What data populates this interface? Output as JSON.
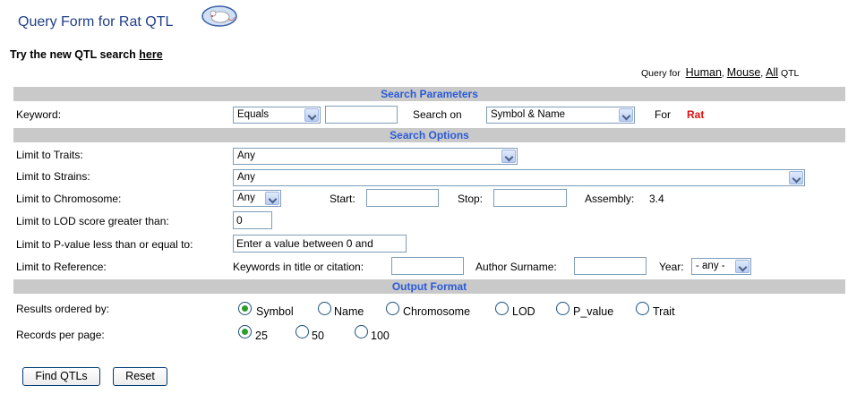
{
  "header": {
    "title": "Query Form for Rat QTL",
    "try_prefix": "Try the new QTL search",
    "try_link": "here"
  },
  "query_for": {
    "prefix": "Query for",
    "links": [
      "Human",
      "Mouse",
      "All"
    ],
    "suffix": "QTL"
  },
  "sections": {
    "search_parameters": "Search Parameters",
    "search_options": "Search Options",
    "output_format": "Output Format"
  },
  "keyword": {
    "label": "Keyword:",
    "match_select": "Equals",
    "value": "",
    "search_on_label": "Search on",
    "search_on_select": "Symbol & Name",
    "for_label": "For",
    "species": "Rat"
  },
  "options": {
    "traits_label": "Limit to Traits:",
    "traits_select": "Any",
    "strains_label": "Limit to Strains:",
    "strains_select": "Any",
    "chromosome_label": "Limit to Chromosome:",
    "chromosome_select": "Any",
    "start_label": "Start:",
    "stop_label": "Stop:",
    "assembly_label": "Assembly:",
    "assembly_value": "3.4",
    "lod_label": "Limit to LOD score greater than:",
    "lod_value": "0",
    "pvalue_label": "Limit to P-value less than or equal to:",
    "pvalue_placeholder": "Enter a value between 0 and",
    "reference_label": "Limit to Reference:",
    "ref_keywords_label": "Keywords in title or citation:",
    "ref_author_label": "Author Surname:",
    "ref_year_label": "Year:",
    "ref_year_select": "- any -"
  },
  "output": {
    "order_label": "Results ordered by:",
    "order_options": [
      "Symbol",
      "Name",
      "Chromosome",
      "LOD",
      "P_value",
      "Trait"
    ],
    "order_selected": "Symbol",
    "records_label": "Records per page:",
    "records_options": [
      "25",
      "50",
      "100"
    ],
    "records_selected": "25"
  },
  "buttons": {
    "find": "Find QTLs",
    "reset": "Reset"
  },
  "colors": {
    "title": "#1f3f88",
    "section_text": "#2a5bd7",
    "section_bg": "#c9c9c9",
    "species": "#e01010",
    "radio_selected": "#2a9d2a"
  },
  "icons": {
    "logo": "rat-logo-icon"
  }
}
